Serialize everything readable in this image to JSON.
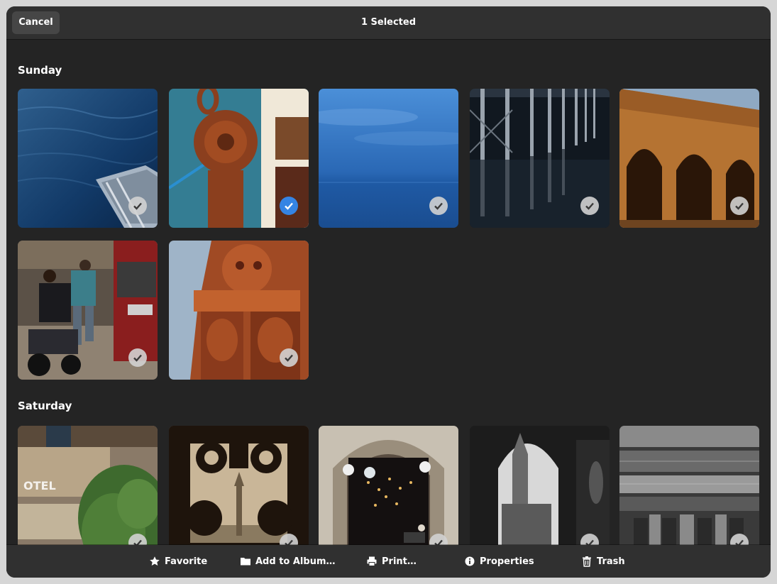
{
  "header": {
    "cancel_label": "Cancel",
    "title": "1 Selected"
  },
  "sections": [
    {
      "label": "Sunday"
    },
    {
      "label": "Saturday"
    }
  ],
  "photos": {
    "sunday": [
      {
        "subject": "sea with boat dock",
        "selected": false
      },
      {
        "subject": "rusty chain and pulley",
        "selected": true
      },
      {
        "subject": "blue sea horizon",
        "selected": false
      },
      {
        "subject": "pier pillars reflection",
        "selected": false
      },
      {
        "subject": "stone arches",
        "selected": false
      },
      {
        "subject": "street scene with motorbike",
        "selected": false
      },
      {
        "subject": "carved terracotta statue",
        "selected": false
      }
    ],
    "saturday": [
      {
        "subject": "hotel sign building",
        "selected": false
      },
      {
        "subject": "ornate window silhouette",
        "selected": false
      },
      {
        "subject": "arched doorway with lamps",
        "selected": false
      },
      {
        "subject": "minaret through arch",
        "selected": false
      },
      {
        "subject": "ornate dome interior",
        "selected": false
      }
    ]
  },
  "toolbar": {
    "favorite_label": "Favorite",
    "add_album_label": "Add to Album…",
    "print_label": "Print…",
    "properties_label": "Properties",
    "trash_label": "Trash"
  },
  "colors": {
    "accent": "#3584e4",
    "background": "#242424",
    "headerbar": "#303030"
  }
}
